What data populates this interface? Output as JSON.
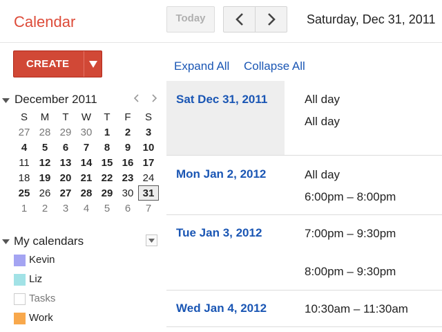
{
  "app": {
    "title": "Calendar"
  },
  "toolbar": {
    "today_label": "Today",
    "current_date": "Saturday, Dec 31, 2011"
  },
  "create": {
    "label": "CREATE"
  },
  "mini_calendar": {
    "title": "December 2011",
    "weekdays": [
      "S",
      "M",
      "T",
      "W",
      "T",
      "F",
      "S"
    ],
    "weeks": [
      [
        {
          "d": "27",
          "s": "other"
        },
        {
          "d": "28",
          "s": "other"
        },
        {
          "d": "29",
          "s": "other"
        },
        {
          "d": "30",
          "s": "other"
        },
        {
          "d": "1",
          "s": "busy"
        },
        {
          "d": "2",
          "s": "busy"
        },
        {
          "d": "3",
          "s": "busy"
        }
      ],
      [
        {
          "d": "4",
          "s": "busy"
        },
        {
          "d": "5",
          "s": "busy"
        },
        {
          "d": "6",
          "s": "busy"
        },
        {
          "d": "7",
          "s": "busy"
        },
        {
          "d": "8",
          "s": "busy"
        },
        {
          "d": "9",
          "s": "busy"
        },
        {
          "d": "10",
          "s": "busy"
        }
      ],
      [
        {
          "d": "11",
          "s": "plain"
        },
        {
          "d": "12",
          "s": "busy"
        },
        {
          "d": "13",
          "s": "busy"
        },
        {
          "d": "14",
          "s": "busy"
        },
        {
          "d": "15",
          "s": "busy"
        },
        {
          "d": "16",
          "s": "busy"
        },
        {
          "d": "17",
          "s": "busy"
        }
      ],
      [
        {
          "d": "18",
          "s": "plain"
        },
        {
          "d": "19",
          "s": "busy"
        },
        {
          "d": "20",
          "s": "busy"
        },
        {
          "d": "21",
          "s": "busy"
        },
        {
          "d": "22",
          "s": "busy"
        },
        {
          "d": "23",
          "s": "busy"
        },
        {
          "d": "24",
          "s": "plain"
        }
      ],
      [
        {
          "d": "25",
          "s": "busy"
        },
        {
          "d": "26",
          "s": "plain"
        },
        {
          "d": "27",
          "s": "busy"
        },
        {
          "d": "28",
          "s": "busy"
        },
        {
          "d": "29",
          "s": "busy"
        },
        {
          "d": "30",
          "s": "plain"
        },
        {
          "d": "31",
          "s": "selected"
        }
      ],
      [
        {
          "d": "1",
          "s": "other"
        },
        {
          "d": "2",
          "s": "other"
        },
        {
          "d": "3",
          "s": "other"
        },
        {
          "d": "4",
          "s": "other"
        },
        {
          "d": "5",
          "s": "other"
        },
        {
          "d": "6",
          "s": "other"
        },
        {
          "d": "7",
          "s": "other"
        }
      ]
    ]
  },
  "my_calendars": {
    "title": "My calendars",
    "items": [
      {
        "name": "Kevin",
        "color": "#a4a4f2",
        "enabled": true
      },
      {
        "name": "Liz",
        "color": "#a2e2e6",
        "enabled": true
      },
      {
        "name": "Tasks",
        "color": "#ffffff",
        "enabled": false
      },
      {
        "name": "Work",
        "color": "#f8a84c",
        "enabled": true
      }
    ]
  },
  "agenda": {
    "expand_all": "Expand All",
    "collapse_all": "Collapse All",
    "days": [
      {
        "date": "Sat Dec 31, 2011",
        "highlight": true,
        "events": [
          "All day",
          "All day"
        ]
      },
      {
        "date": "Mon Jan 2, 2012",
        "highlight": false,
        "events": [
          "All day",
          "6:00pm – 8:00pm"
        ]
      },
      {
        "date": "Tue Jan 3, 2012",
        "highlight": false,
        "events": [
          "7:00pm – 9:30pm",
          "8:00pm – 9:30pm"
        ]
      },
      {
        "date": "Wed Jan 4, 2012",
        "highlight": false,
        "events": [
          "10:30am – 11:30am"
        ]
      }
    ]
  },
  "colors": {
    "brand": "#dd4b39",
    "create": "#d14836",
    "link": "#1a56b4",
    "selected_day_bg": "#eeeeee"
  }
}
